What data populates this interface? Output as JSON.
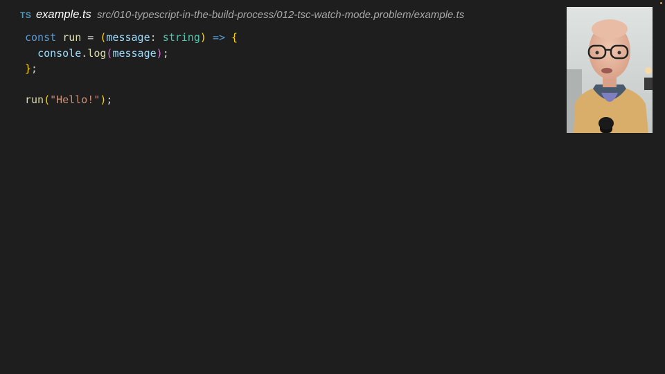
{
  "tab": {
    "language_badge": "TS",
    "filename": "example.ts",
    "path": "src/010-typescript-in-the-build-process/012-tsc-watch-mode.problem/example.ts"
  },
  "code": {
    "lines": [
      [
        {
          "t": "const",
          "c": "keyword"
        },
        {
          "t": " ",
          "c": "punct"
        },
        {
          "t": "run",
          "c": "fn"
        },
        {
          "t": " = ",
          "c": "punct"
        },
        {
          "t": "(",
          "c": "bracket1"
        },
        {
          "t": "message",
          "c": "param"
        },
        {
          "t": ": ",
          "c": "punct"
        },
        {
          "t": "string",
          "c": "type"
        },
        {
          "t": ")",
          "c": "bracket1"
        },
        {
          "t": " ",
          "c": "punct"
        },
        {
          "t": "=>",
          "c": "keyword"
        },
        {
          "t": " ",
          "c": "punct"
        },
        {
          "t": "{",
          "c": "bracket1"
        }
      ],
      [
        {
          "t": "  ",
          "c": "punct"
        },
        {
          "t": "console",
          "c": "var"
        },
        {
          "t": ".",
          "c": "punct"
        },
        {
          "t": "log",
          "c": "fn"
        },
        {
          "t": "(",
          "c": "bracket2"
        },
        {
          "t": "message",
          "c": "var"
        },
        {
          "t": ")",
          "c": "bracket2"
        },
        {
          "t": ";",
          "c": "punct"
        }
      ],
      [
        {
          "t": "}",
          "c": "bracket1"
        },
        {
          "t": ";",
          "c": "punct"
        }
      ],
      [],
      [
        {
          "t": "run",
          "c": "fn"
        },
        {
          "t": "(",
          "c": "bracket1"
        },
        {
          "t": "\"Hello!\"",
          "c": "string"
        },
        {
          "t": ")",
          "c": "bracket1"
        },
        {
          "t": ";",
          "c": "punct"
        }
      ]
    ]
  },
  "webcam": {
    "icon": "presenter-webcam"
  },
  "colors": {
    "background": "#1e1e1e",
    "keyword": "#569cd6",
    "function": "#dcdcaa",
    "parameter": "#9cdcfe",
    "type": "#4ec9b0",
    "string": "#ce9178",
    "bracket_level1": "#ffd700",
    "bracket_level2": "#da70d6",
    "ts_badge": "#519aba"
  }
}
